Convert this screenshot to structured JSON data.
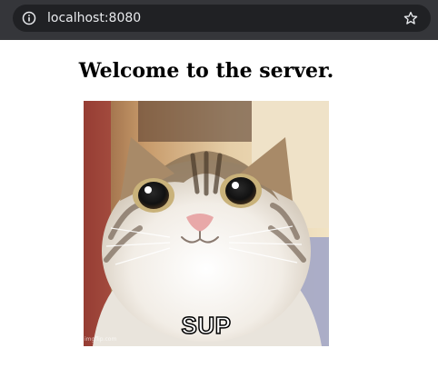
{
  "browser": {
    "url": "localhost:8080",
    "icons": {
      "info": "info-icon",
      "bookmark": "star-icon"
    }
  },
  "page": {
    "heading": "Welcome to the server.",
    "image": {
      "caption": "SUP",
      "watermark": "imgflip.com"
    }
  },
  "colors": {
    "toolbar": "#35363a",
    "url_field": "#202124",
    "url_text": "#e8eaed",
    "page_background": "#ffffff"
  }
}
